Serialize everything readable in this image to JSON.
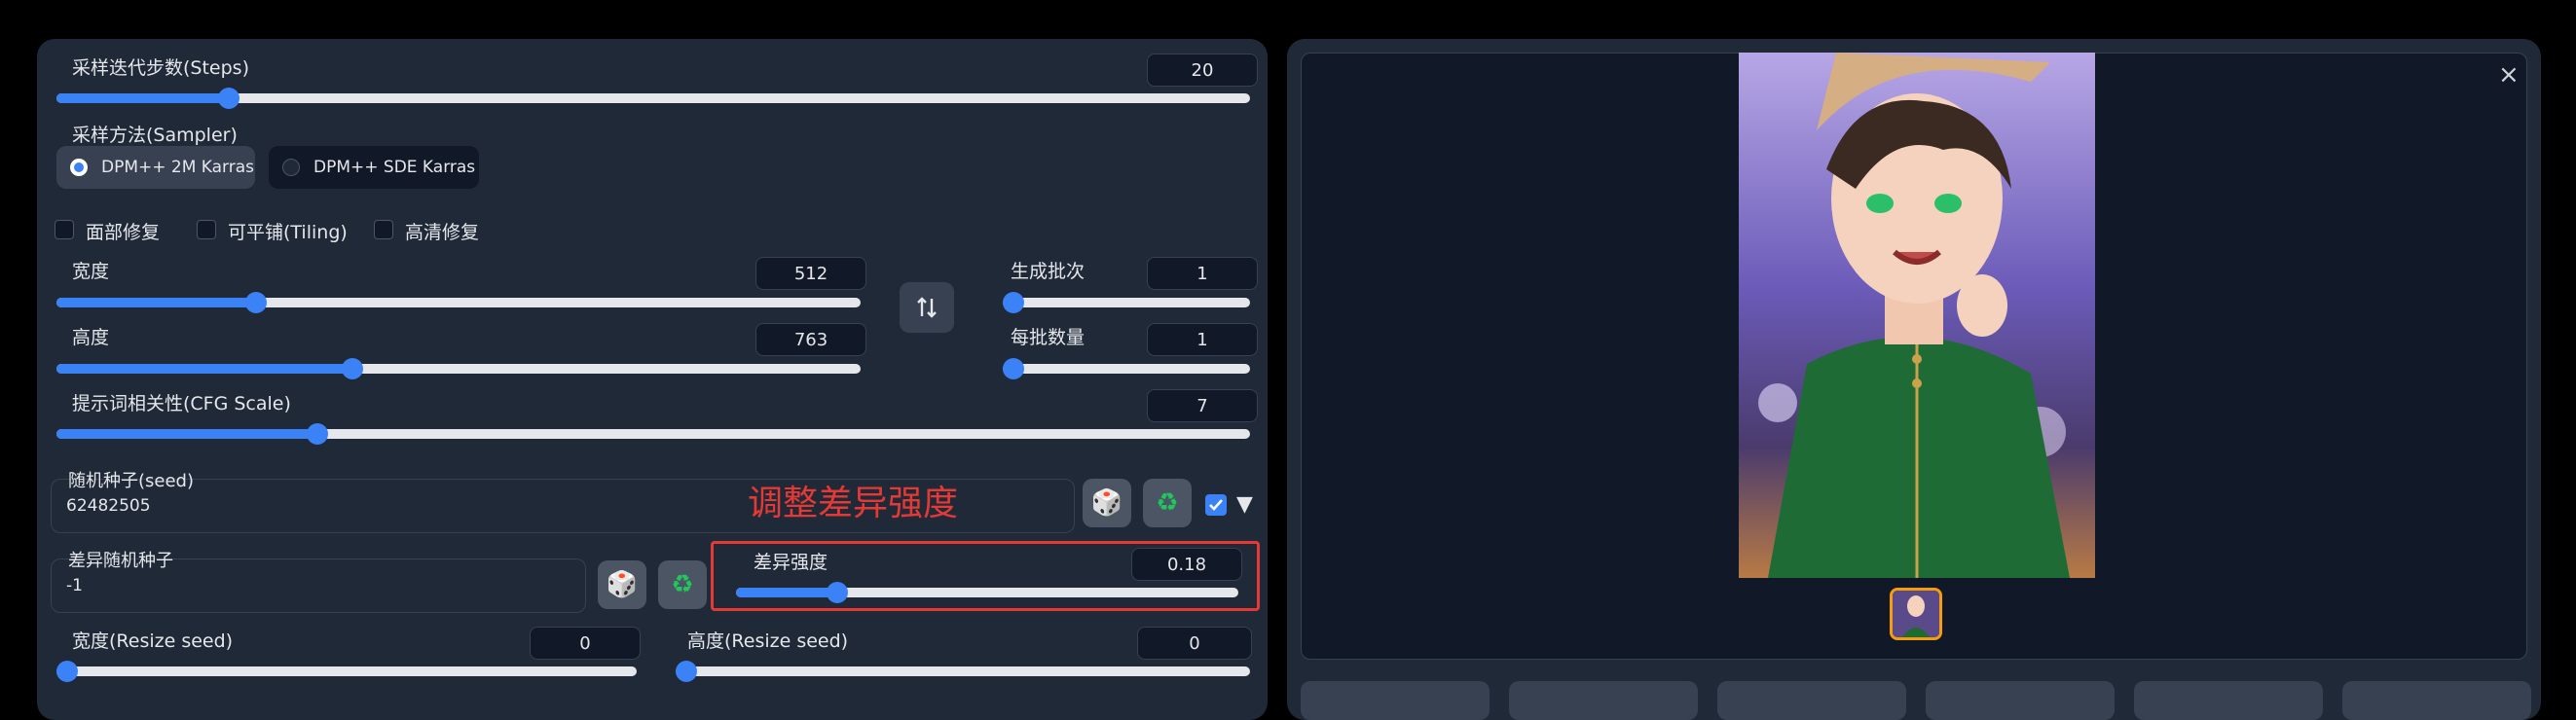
{
  "steps": {
    "label": "采样迭代步数(Steps)",
    "value": "20",
    "fraction": 0.135
  },
  "sampler": {
    "label": "采样方法(Sampler)",
    "options": [
      {
        "label": "DPM++ 2M Karras",
        "selected": true
      },
      {
        "label": "DPM++ SDE Karras",
        "selected": false
      }
    ]
  },
  "options": {
    "face_restore": {
      "label": "面部修复",
      "checked": false
    },
    "tiling": {
      "label": "可平铺(Tiling)",
      "checked": false
    },
    "hires_fix": {
      "label": "高清修复",
      "checked": false
    }
  },
  "width": {
    "label": "宽度",
    "value": "512",
    "fraction": 0.235
  },
  "height": {
    "label": "高度",
    "value": "763",
    "fraction": 0.355
  },
  "swap_icon": "swap-vertical-arrows",
  "batch_count": {
    "label": "生成批次",
    "value": "1",
    "fraction": 0.0
  },
  "batch_size": {
    "label": "每批数量",
    "value": "1",
    "fraction": 0.0
  },
  "cfg": {
    "label": "提示词相关性(CFG Scale)",
    "value": "7",
    "fraction": 0.21
  },
  "seed": {
    "label": "随机种子(seed)",
    "value": "62482505"
  },
  "annotation": {
    "text": "调整差异强度",
    "color": "#e53935"
  },
  "variation_seed": {
    "label": "差异随机种子",
    "value": "-1"
  },
  "variation_strength": {
    "label": "差异强度",
    "value": "0.18",
    "fraction": 0.18
  },
  "resize_width": {
    "label": "宽度(Resize seed)",
    "value": "0",
    "fraction": 0.0
  },
  "resize_height": {
    "label": "高度(Resize seed)",
    "value": "0",
    "fraction": 0.0
  },
  "icons": {
    "dice": "dice-icon",
    "recycle": "recycle-icon",
    "close": "close-icon"
  },
  "close_glyph": "×",
  "colors": {
    "accent": "#3b82f6",
    "panel": "#1f2937",
    "highlight": "#e53935"
  }
}
